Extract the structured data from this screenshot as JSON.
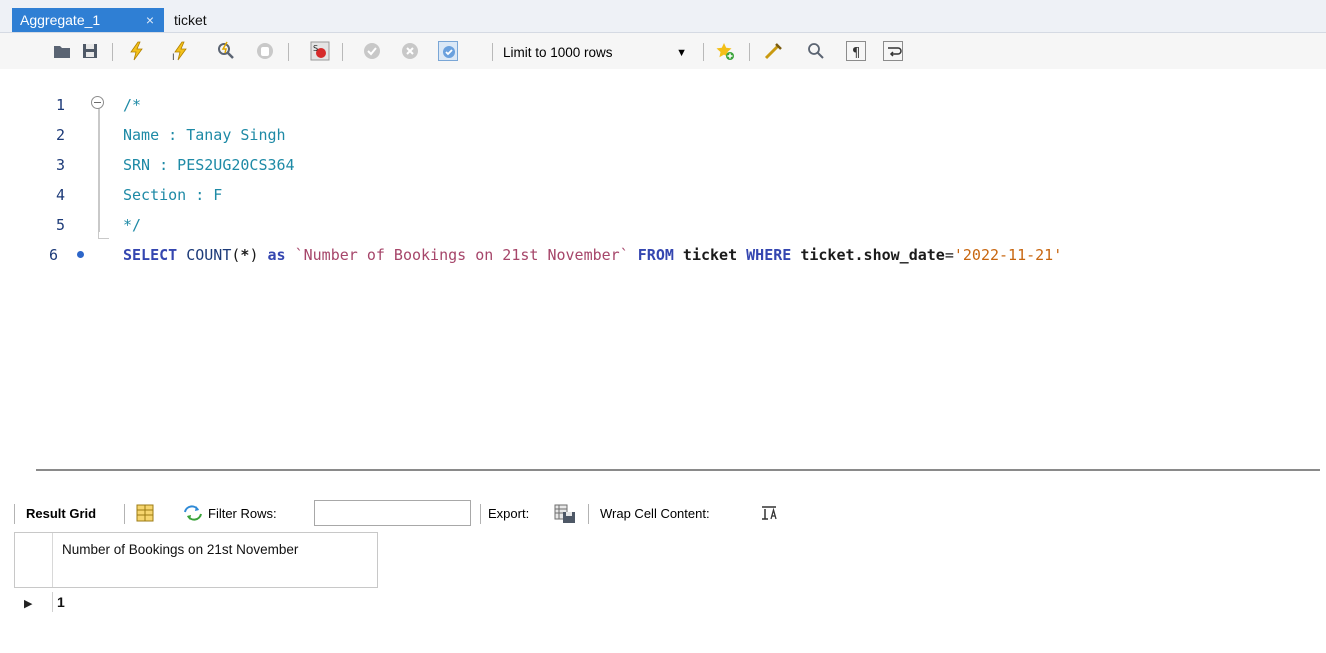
{
  "tabs": [
    {
      "label": "Aggregate_1",
      "active": true,
      "close": "×"
    },
    {
      "label": "ticket",
      "active": false
    }
  ],
  "toolbar": {
    "buttons": [
      "open-folder-icon",
      "save-icon",
      "execute-icon",
      "execute-current-icon",
      "explain-icon",
      "stop-icon",
      "toggle-error-icon",
      "commit-icon",
      "rollback-icon",
      "autocommit-icon",
      "add-snippet-icon",
      "beautify-icon",
      "find-icon",
      "invisible-chars-icon",
      "wrap-icon"
    ],
    "limit_label": "Limit to 1000 rows"
  },
  "editor": {
    "lines": [
      {
        "n": "1",
        "text": "/*"
      },
      {
        "n": "2",
        "text": "Name : Tanay Singh"
      },
      {
        "n": "3",
        "text": "SRN : PES2UG20CS364"
      },
      {
        "n": "4",
        "text": "Section : F"
      },
      {
        "n": "5",
        "text": "*/"
      },
      {
        "n": "6",
        "tokens": {
          "select": "SELECT",
          "count": "COUNT",
          "paren_open": "(",
          "star": "*",
          "paren_close": ")",
          "as": "as",
          "alias": "`Number of Bookings on 21st November`",
          "from": "FROM",
          "table": "ticket",
          "where": "WHERE",
          "column": "ticket.show_date",
          "eq": "=",
          "value": "'2022-11-21'"
        }
      }
    ]
  },
  "results": {
    "result_grid_label": "Result Grid",
    "filter_label": "Filter Rows:",
    "filter_value": "",
    "export_label": "Export:",
    "wrap_label": "Wrap Cell Content:",
    "column_header": "Number of Bookings on 21st November",
    "rows": [
      "1"
    ]
  },
  "colors": {
    "tab_active": "#2f7fd4",
    "keyword": "#3446b0",
    "comment": "#1e8aa6",
    "string": "#a6466a",
    "literal": "#c8660f"
  }
}
